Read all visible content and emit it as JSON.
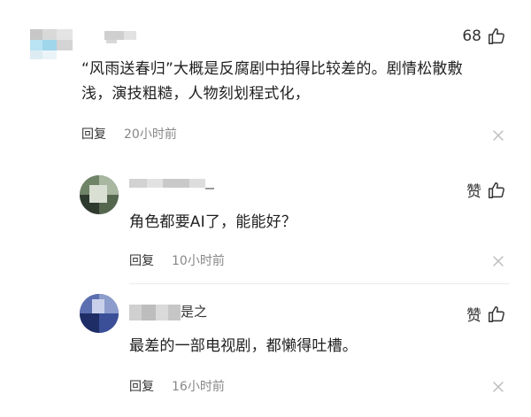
{
  "comments": [
    {
      "likes": "68",
      "text_line1": "“风雨送春归”大概是反腐剧中拍得比较差的。剧情松散敷",
      "text_line2": "浅，演技粗糙，人物刻划程式化，",
      "reply_label": "回复",
      "time": "20小时前"
    },
    {
      "like_label": "赞",
      "text_line1": "角色都要AI了，能能好？",
      "reply_label": "回复",
      "time": "10小时前"
    },
    {
      "username_fragment": "是之",
      "like_label": "赞",
      "text_line1": "最差的一部电视剧，都懒得吐槽。",
      "reply_label": "回复",
      "time": "16小时前"
    }
  ],
  "icons": {
    "like": "thumbs-up-icon",
    "dismiss": "close-icon"
  },
  "colors": {
    "text": "#1f1f1f",
    "secondary": "#888888",
    "divider": "#ebebeb",
    "icon_stroke": "#333333"
  }
}
